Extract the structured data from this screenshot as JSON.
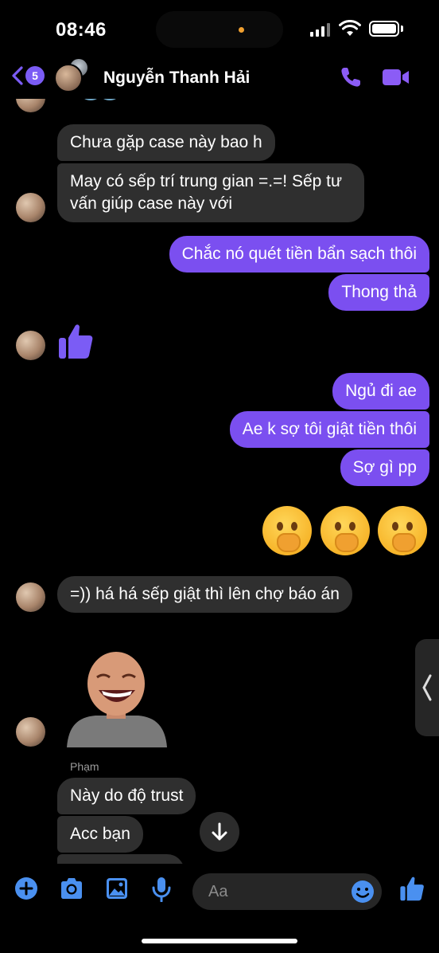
{
  "status_bar": {
    "time": "08:46"
  },
  "header": {
    "back_badge": "5",
    "contact_name": "Nguyễn Thanh Hải",
    "icons": [
      "back-chevron-icon",
      "phone-icon",
      "video-camera-icon"
    ]
  },
  "messages": [
    {
      "dir": "in",
      "text": "Chưa gặp case này bao h"
    },
    {
      "dir": "in",
      "text": "May có sếp trí trung gian =.=! Sếp tư vấn giúp case này với"
    },
    {
      "dir": "out",
      "text": "Chắc nó quét tiền bẩn sạch thôi"
    },
    {
      "dir": "out",
      "text": "Thong thả"
    },
    {
      "dir": "in",
      "type": "like-icon"
    },
    {
      "dir": "out",
      "text": "Ngủ đi ae"
    },
    {
      "dir": "out",
      "text": "Ae k sợ tôi giật tiền thôi"
    },
    {
      "dir": "out",
      "text": "Sợ gì pp"
    },
    {
      "dir": "out",
      "type": "emoji",
      "emoji": "hand-over-mouth-emoji",
      "count": 3
    },
    {
      "dir": "in",
      "text": "=)) há há sếp giật thì lên chợ báo án"
    },
    {
      "dir": "in",
      "type": "sticker",
      "sticker": "laughing-man-sticker"
    },
    {
      "dir": "in",
      "sender": "Phạm",
      "text": "Này do độ trust"
    },
    {
      "dir": "in",
      "text": "Acc bạn"
    }
  ],
  "composer": {
    "placeholder": "Aa",
    "icons": [
      "plus-icon",
      "camera-icon",
      "image-icon",
      "microphone-icon",
      "emoji-icon",
      "like-icon"
    ]
  },
  "colors": {
    "accent": "#7b4ff0",
    "incoming_bubble": "#2f2f2f",
    "background": "#000000"
  }
}
